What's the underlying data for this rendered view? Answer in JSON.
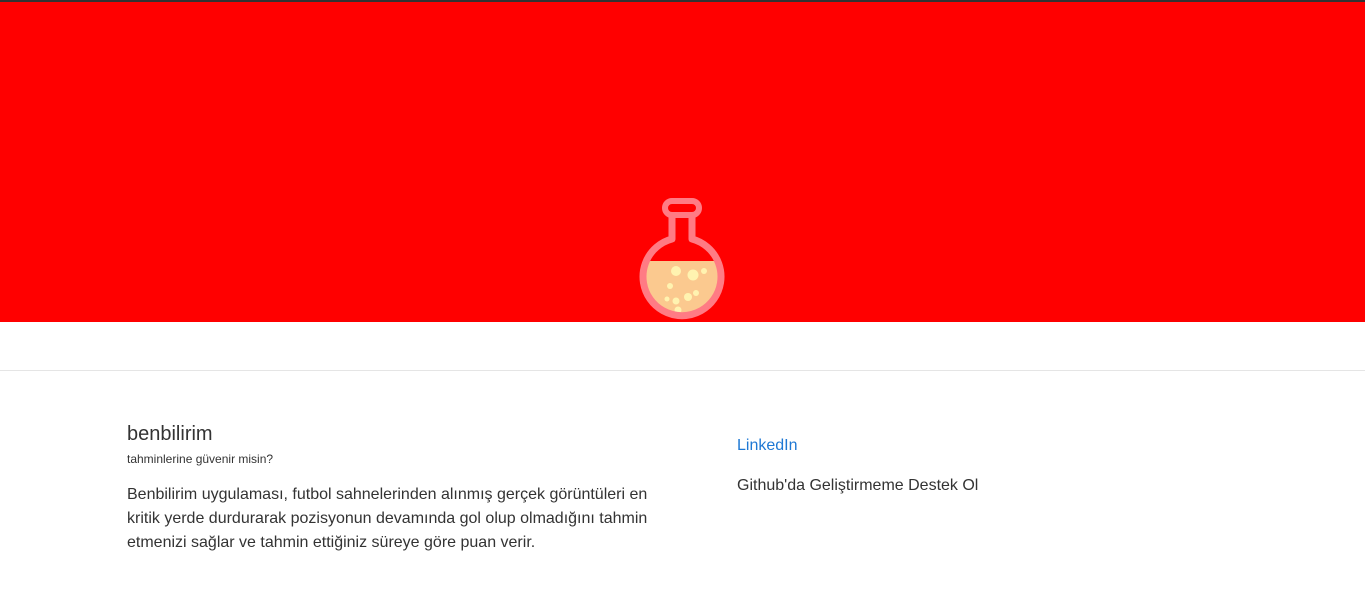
{
  "colors": {
    "hero_background": "#ff0000",
    "link": "#1e78d4",
    "text": "#333333"
  },
  "hero": {
    "logo_icon": "flask-icon"
  },
  "about": {
    "title": "benbilirim",
    "subtitle": "tahminlerine güvenir misin?",
    "description": "Benbilirim uygulaması, futbol sahnelerinden alınmış gerçek görüntüleri en kritik yerde durdurarak pozisyonun devamında gol olup olmadığını tahmin etmenizi sağlar ve tahmin ettiğiniz süreye göre puan verir."
  },
  "links": {
    "linkedin_label": "LinkedIn",
    "github_label": "Github'da Geliştirmeme Destek Ol"
  }
}
